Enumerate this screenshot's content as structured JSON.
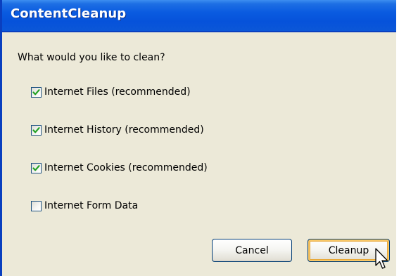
{
  "window": {
    "title": "ContentCleanup"
  },
  "prompt": "What would you like to clean?",
  "options": [
    {
      "label": "Internet Files (recommended)",
      "checked": true
    },
    {
      "label": "Internet History (recommended)",
      "checked": true
    },
    {
      "label": "Internet Cookies (recommended)",
      "checked": true
    },
    {
      "label": "Internet Form Data",
      "checked": false
    }
  ],
  "buttons": {
    "cancel": "Cancel",
    "cleanup": "Cleanup"
  },
  "colors": {
    "titlebar": "#0a5be0",
    "check": "#21a121",
    "dialog_bg": "#ece9d8",
    "default_button_focus": "#f9c867"
  },
  "icons": {
    "check": "check-icon",
    "cursor": "mouse-pointer-icon"
  }
}
